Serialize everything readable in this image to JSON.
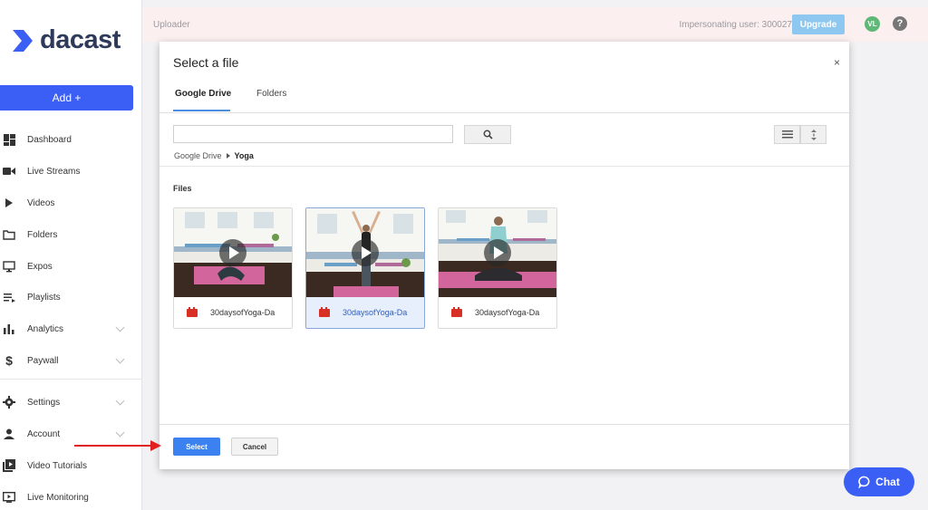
{
  "brand": {
    "name": "dacast"
  },
  "sidebar": {
    "add_label": "Add +",
    "items": [
      {
        "label": "Dashboard",
        "icon": "dashboard-icon",
        "has_chevron": false
      },
      {
        "label": "Live Streams",
        "icon": "camera-icon",
        "has_chevron": false
      },
      {
        "label": "Videos",
        "icon": "play-icon",
        "has_chevron": false
      },
      {
        "label": "Folders",
        "icon": "folder-icon",
        "has_chevron": false
      },
      {
        "label": "Expos",
        "icon": "monitor-icon",
        "has_chevron": false
      },
      {
        "label": "Playlists",
        "icon": "playlist-icon",
        "has_chevron": false
      },
      {
        "label": "Analytics",
        "icon": "bar-chart-icon",
        "has_chevron": true
      },
      {
        "label": "Paywall",
        "icon": "dollar-icon",
        "has_chevron": true
      },
      {
        "label": "Settings",
        "icon": "gear-icon",
        "has_chevron": true
      },
      {
        "label": "Account",
        "icon": "user-icon",
        "has_chevron": true
      },
      {
        "label": "Video Tutorials",
        "icon": "video-library-icon",
        "has_chevron": false
      },
      {
        "label": "Live Monitoring",
        "icon": "live-monitor-icon",
        "has_chevron": false
      }
    ]
  },
  "topbar": {
    "title": "Uploader",
    "impersonating": "Impersonating user: 300027",
    "upgrade_label": "Upgrade",
    "avatar_initials": "VL",
    "help_label": "?"
  },
  "modal": {
    "title": "Select a file",
    "close_label": "×",
    "tabs": [
      {
        "label": "Google Drive",
        "active": true
      },
      {
        "label": "Folders",
        "active": false
      }
    ],
    "search": {
      "placeholder": "",
      "value": ""
    },
    "breadcrumb": {
      "root": "Google Drive",
      "current": "Yoga"
    },
    "files_label": "Files",
    "files": [
      {
        "name": "30daysofYoga-Da",
        "selected": false
      },
      {
        "name": "30daysofYoga-Da",
        "selected": true
      },
      {
        "name": "30daysofYoga-Da",
        "selected": false
      }
    ],
    "select_label": "Select",
    "cancel_label": "Cancel"
  },
  "chat": {
    "label": "Chat"
  },
  "colors": {
    "accent": "#3b5ef5",
    "select_button": "#3b82f0",
    "upgrade": "#8ec8f0",
    "arrow": "#e02020"
  }
}
